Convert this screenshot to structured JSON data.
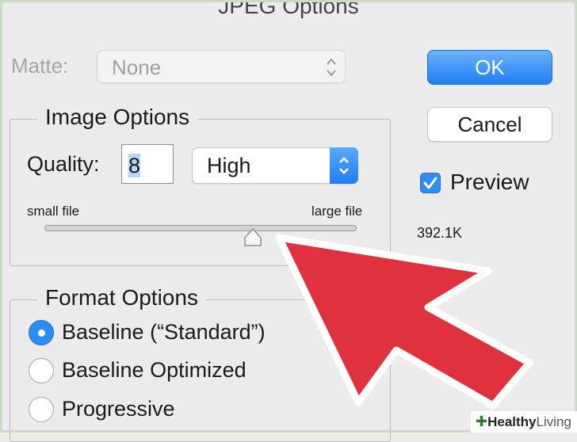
{
  "dialog": {
    "title": "JPEG Options"
  },
  "matte": {
    "label": "Matte:",
    "value": "None",
    "icon": "up-down-chevrons-icon"
  },
  "buttons": {
    "ok_label": "OK",
    "cancel_label": "Cancel"
  },
  "preview": {
    "label": "Preview",
    "checked": true,
    "file_size": "392.1K"
  },
  "image_options": {
    "title": "Image Options",
    "quality_label": "Quality:",
    "quality_value": "8",
    "quality_preset": "High",
    "slider": {
      "min_label": "small file",
      "max_label": "large file",
      "value": 8,
      "max": 12
    }
  },
  "format_options": {
    "title": "Format Options",
    "options": [
      {
        "label": "Baseline (“Standard”)",
        "selected": true
      },
      {
        "label": "Baseline Optimized",
        "selected": false
      },
      {
        "label": "Progressive",
        "selected": false
      }
    ]
  },
  "overlay": {
    "icon": "red-arrow-icon",
    "color": "#e0313f"
  },
  "watermark": {
    "word1": "Healthy",
    "word2": "Living"
  },
  "colors": {
    "accent": "#2d8cf5",
    "arrow": "#e0313f",
    "background": "#ececec"
  }
}
